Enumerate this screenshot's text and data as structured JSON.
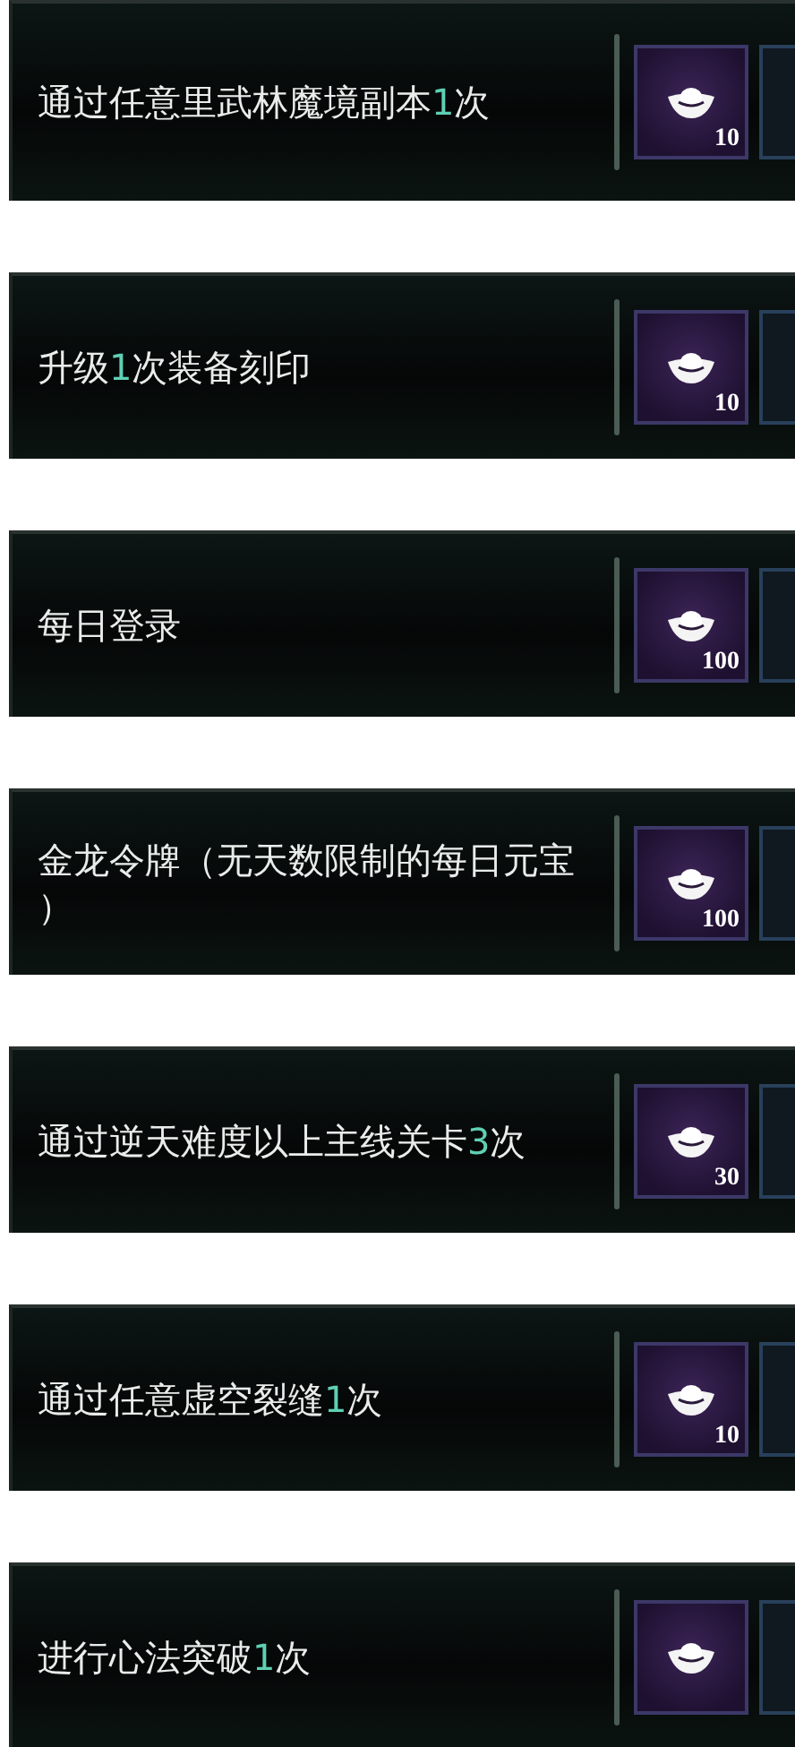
{
  "tasks": [
    {
      "title_parts": [
        {
          "text": "通过任意里武林魔境副本",
          "highlight": false
        },
        {
          "text": "1",
          "highlight": true
        },
        {
          "text": "次",
          "highlight": false
        }
      ],
      "reward": {
        "amount": "10"
      }
    },
    {
      "title_parts": [
        {
          "text": "升级",
          "highlight": false
        },
        {
          "text": "1",
          "highlight": true
        },
        {
          "text": "次装备刻印",
          "highlight": false
        }
      ],
      "reward": {
        "amount": "10"
      }
    },
    {
      "title_parts": [
        {
          "text": "每日登录",
          "highlight": false
        }
      ],
      "reward": {
        "amount": "100"
      }
    },
    {
      "title_parts": [
        {
          "text": "金龙令牌（无天数限制的每日元宝）",
          "highlight": false
        }
      ],
      "reward": {
        "amount": "100"
      }
    },
    {
      "title_parts": [
        {
          "text": "通过逆天难度以上主线关卡",
          "highlight": false
        },
        {
          "text": "3",
          "highlight": true
        },
        {
          "text": "次",
          "highlight": false
        }
      ],
      "reward": {
        "amount": "30"
      }
    },
    {
      "title_parts": [
        {
          "text": "通过任意虚空裂缝",
          "highlight": false
        },
        {
          "text": "1",
          "highlight": true
        },
        {
          "text": "次",
          "highlight": false
        }
      ],
      "reward": {
        "amount": "10"
      }
    },
    {
      "title_parts": [
        {
          "text": "进行心法突破",
          "highlight": false
        },
        {
          "text": "1",
          "highlight": true
        },
        {
          "text": "次",
          "highlight": false
        }
      ]
    }
  ]
}
